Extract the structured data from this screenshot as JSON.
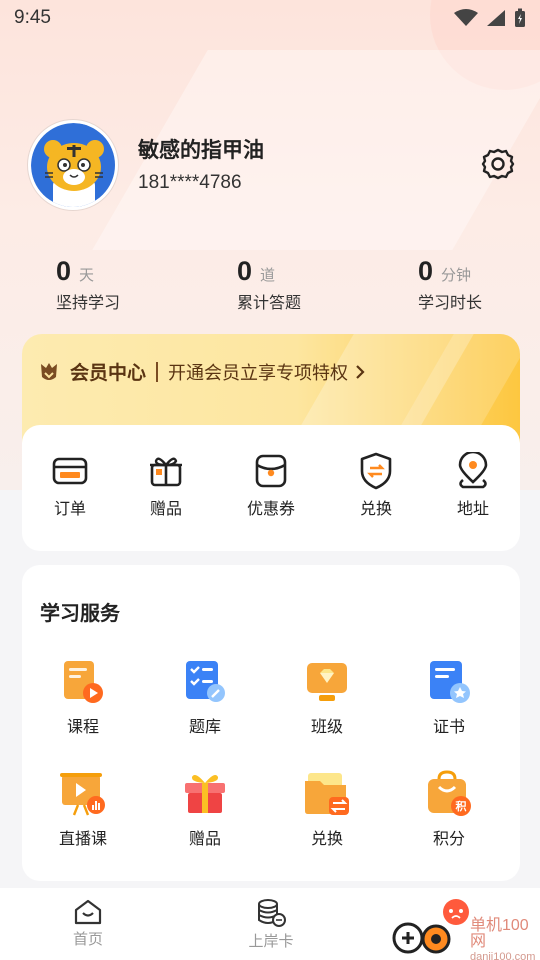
{
  "status_bar": {
    "time": "9:45"
  },
  "profile": {
    "username": "敏感的指甲油",
    "phone": "181****4786"
  },
  "stats": [
    {
      "value": "0",
      "unit": "天",
      "label": "坚持学习"
    },
    {
      "value": "0",
      "unit": "道",
      "label": "累计答题"
    },
    {
      "value": "0",
      "unit": "分钟",
      "label": "学习时长"
    }
  ],
  "vip": {
    "title": "会员中心",
    "subtitle": "开通会员立享专项特权"
  },
  "orders": [
    {
      "label": "订单",
      "icon": "wallet-icon"
    },
    {
      "label": "赠品",
      "icon": "gift-icon"
    },
    {
      "label": "优惠券",
      "icon": "coupon-icon"
    },
    {
      "label": "兑换",
      "icon": "exchange-shield-icon"
    },
    {
      "label": "地址",
      "icon": "location-pin-icon"
    }
  ],
  "services": {
    "title": "学习服务",
    "items": [
      {
        "label": "课程",
        "icon": "course-icon"
      },
      {
        "label": "题库",
        "icon": "question-bank-icon"
      },
      {
        "label": "班级",
        "icon": "class-icon"
      },
      {
        "label": "证书",
        "icon": "certificate-icon"
      },
      {
        "label": "直播课",
        "icon": "live-class-icon"
      },
      {
        "label": "赠品",
        "icon": "gift-box-icon"
      },
      {
        "label": "兑换",
        "icon": "exchange-folder-icon"
      },
      {
        "label": "积分",
        "icon": "points-bag-icon"
      }
    ]
  },
  "tabbar": {
    "home": "首页",
    "card": "上岸卡"
  },
  "watermark": {
    "name": "单机100网",
    "domain": "danji100.com"
  },
  "colors": {
    "accent_orange": "#ff8a1f",
    "vip_gold": "#fdc740",
    "text_dark": "#222222",
    "text_muted": "#999999"
  }
}
